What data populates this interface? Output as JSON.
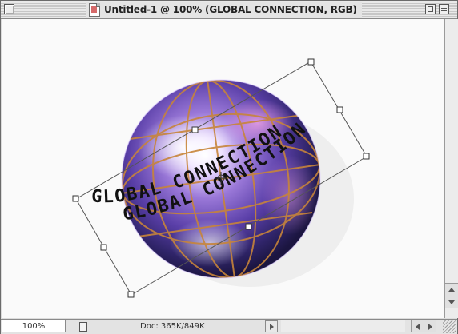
{
  "window": {
    "title": "Untitled-1 @ 100% (GLOBAL CONNECTION, RGB)"
  },
  "canvas": {
    "arc_text": "GLOBAL CONNECTION",
    "text_color": "#111111",
    "globe_colors": [
      "#2a1f5c",
      "#5a3fa8",
      "#b38ad6",
      "#ffffff"
    ],
    "grid_color": "#c7843a"
  },
  "statusbar": {
    "zoom": "100%",
    "doc_info": "Doc: 365K/849K"
  },
  "icons": {
    "close": "close-box-icon",
    "zoom": "zoom-box-icon",
    "collapse": "collapse-box-icon",
    "document": "document-icon",
    "page": "page-setup-icon",
    "grow": "grow-box-icon"
  }
}
